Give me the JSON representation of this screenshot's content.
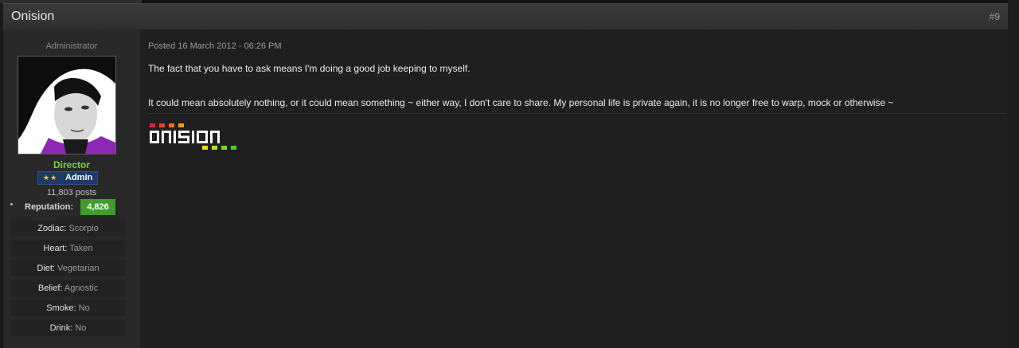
{
  "thread": {
    "title": "Onision",
    "post_number": "#9"
  },
  "author": {
    "group_title": "Administrator",
    "avatar_alt": "avatar",
    "rank": "Director",
    "badge_label": "Admin",
    "posts": "11,803 posts",
    "reputation_label": "Reputation:",
    "reputation_value": "4,826",
    "fields": [
      {
        "label": "Zodiac:",
        "value": "Scorpio"
      },
      {
        "label": "Heart:",
        "value": "Taken"
      },
      {
        "label": "Diet:",
        "value": "Vegetarian"
      },
      {
        "label": "Belief:",
        "value": "Agnostic"
      },
      {
        "label": "Smoke:",
        "value": "No"
      },
      {
        "label": "Drink:",
        "value": "No"
      }
    ]
  },
  "post": {
    "posted": "Posted 16 March 2012 - 06:26 PM",
    "line1": "The fact that you have to ask means I'm doing a good job keeping to myself.",
    "line2": "It could mean absolutely nothing, or it could mean something ~ either way, I don't care to share. My personal life is private again, it is no longer free to warp, mock or otherwise ~"
  },
  "signature": {
    "logo_text": "onision",
    "colors": [
      "#e8203c",
      "#f0402c",
      "#f37020",
      "#f49c1c",
      "#f2dc18",
      "#b9e21c",
      "#74dc24",
      "#3cd428"
    ]
  },
  "colors": {
    "rank": "#78d330",
    "reputation_bg": "#3d9e2a",
    "badge_bg": "#1e3a66"
  }
}
